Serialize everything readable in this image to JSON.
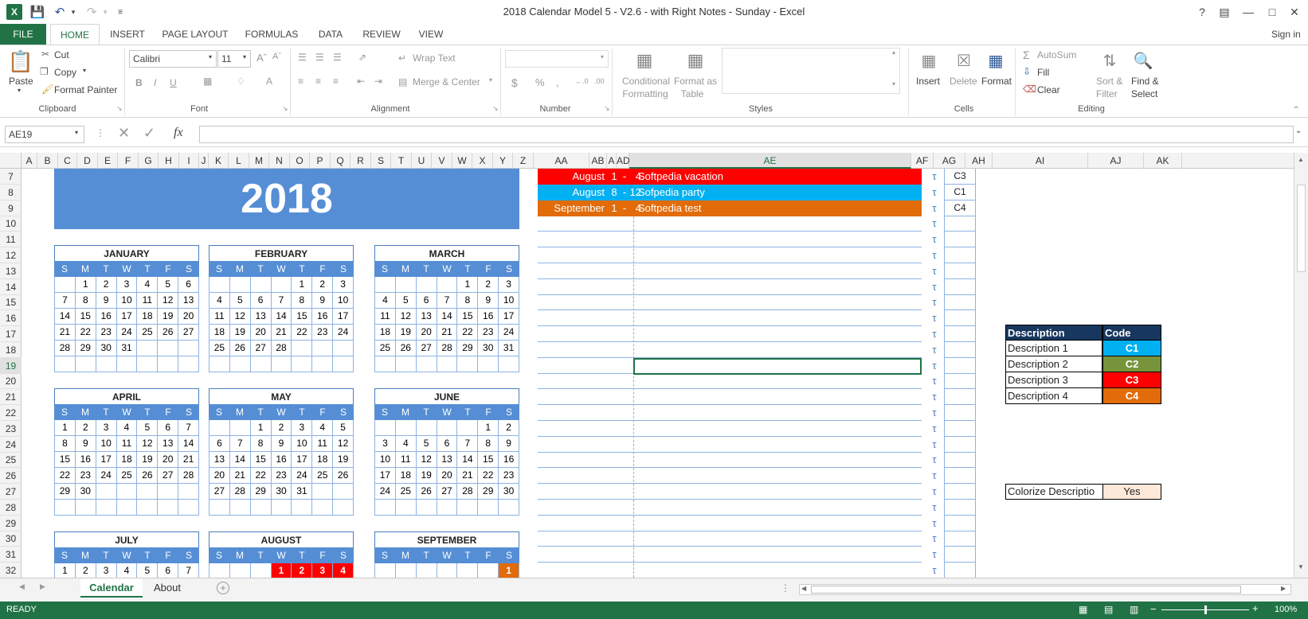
{
  "window": {
    "title": "2018 Calendar Model 5 - V2.6 - with Right Notes - Sunday - Excel",
    "help": "?",
    "signin": "Sign in"
  },
  "tabs": [
    "FILE",
    "HOME",
    "INSERT",
    "PAGE LAYOUT",
    "FORMULAS",
    "DATA",
    "REVIEW",
    "VIEW"
  ],
  "ribbon": {
    "clipboard": {
      "paste": "Paste",
      "cut": "Cut",
      "copy": "Copy",
      "format_painter": "Format Painter",
      "label": "Clipboard"
    },
    "font": {
      "name": "Calibri",
      "size": "11",
      "label": "Font"
    },
    "alignment": {
      "wrap": "Wrap Text",
      "merge": "Merge & Center",
      "label": "Alignment"
    },
    "number": {
      "label": "Number"
    },
    "styles": {
      "cond1": "Conditional",
      "cond2": "Formatting",
      "fmt1": "Format as",
      "fmt2": "Table",
      "label": "Styles"
    },
    "cells": {
      "insert": "Insert",
      "delete": "Delete",
      "format": "Format",
      "label": "Cells"
    },
    "editing": {
      "autosum": "AutoSum",
      "fill": "Fill",
      "clear": "Clear",
      "sort1": "Sort &",
      "sort2": "Filter",
      "find1": "Find &",
      "find2": "Select",
      "label": "Editing"
    }
  },
  "formula_bar": {
    "name_box": "AE19",
    "fx": "fx",
    "content": ""
  },
  "columns": [
    {
      "l": "A",
      "w": 20
    },
    {
      "l": "B",
      "w": 26
    },
    {
      "l": "C",
      "w": 24
    },
    {
      "l": "D",
      "w": 26
    },
    {
      "l": "E",
      "w": 25
    },
    {
      "l": "F",
      "w": 26
    },
    {
      "l": "G",
      "w": 25
    },
    {
      "l": "H",
      "w": 26
    },
    {
      "l": "I",
      "w": 25
    },
    {
      "l": "J",
      "w": 12
    },
    {
      "l": "K",
      "w": 25
    },
    {
      "l": "L",
      "w": 26
    },
    {
      "l": "M",
      "w": 25
    },
    {
      "l": "N",
      "w": 26
    },
    {
      "l": "O",
      "w": 25
    },
    {
      "l": "P",
      "w": 26
    },
    {
      "l": "Q",
      "w": 25
    },
    {
      "l": "R",
      "w": 26
    },
    {
      "l": "S",
      "w": 25
    },
    {
      "l": "T",
      "w": 26
    },
    {
      "l": "U",
      "w": 25
    },
    {
      "l": "V",
      "w": 26
    },
    {
      "l": "W",
      "w": 25
    },
    {
      "l": "X",
      "w": 26
    },
    {
      "l": "Y",
      "w": 25
    },
    {
      "l": "Z",
      "w": 26
    },
    {
      "l": "AA",
      "w": 70
    },
    {
      "l": "AB",
      "w": 22
    },
    {
      "l": "A",
      "w": 12
    },
    {
      "l": "AD",
      "w": 16
    },
    {
      "l": "AE",
      "w": 354
    },
    {
      "l": "AF",
      "w": 28
    },
    {
      "l": "AG",
      "w": 40
    },
    {
      "l": "AH",
      "w": 34
    },
    {
      "l": "AI",
      "w": 120
    },
    {
      "l": "AJ",
      "w": 70
    },
    {
      "l": "AK",
      "w": 48
    }
  ],
  "rows": [
    "7",
    "8",
    "9",
    "10",
    "11",
    "12",
    "13",
    "14",
    "15",
    "16",
    "17",
    "18",
    "19",
    "20",
    "21",
    "22",
    "23",
    "24",
    "25",
    "26",
    "27",
    "28",
    "29",
    "30",
    "31",
    "32"
  ],
  "active_cell": "AE19",
  "year": "2018",
  "dow": [
    "S",
    "M",
    "T",
    "W",
    "T",
    "F",
    "S"
  ],
  "months": [
    {
      "name": "JANUARY",
      "weeks": [
        [
          "",
          "1",
          "2",
          "3",
          "4",
          "5",
          "6"
        ],
        [
          "7",
          "8",
          "9",
          "10",
          "11",
          "12",
          "13"
        ],
        [
          "14",
          "15",
          "16",
          "17",
          "18",
          "19",
          "20"
        ],
        [
          "21",
          "22",
          "23",
          "24",
          "25",
          "26",
          "27"
        ],
        [
          "28",
          "29",
          "30",
          "31",
          "",
          "",
          ""
        ],
        [
          "",
          "",
          "",
          "",
          "",
          "",
          ""
        ]
      ]
    },
    {
      "name": "FEBRUARY",
      "weeks": [
        [
          "",
          "",
          "",
          "",
          "1",
          "2",
          "3"
        ],
        [
          "4",
          "5",
          "6",
          "7",
          "8",
          "9",
          "10"
        ],
        [
          "11",
          "12",
          "13",
          "14",
          "15",
          "16",
          "17"
        ],
        [
          "18",
          "19",
          "20",
          "21",
          "22",
          "23",
          "24"
        ],
        [
          "25",
          "26",
          "27",
          "28",
          "",
          "",
          ""
        ],
        [
          "",
          "",
          "",
          "",
          "",
          "",
          ""
        ]
      ]
    },
    {
      "name": "MARCH",
      "weeks": [
        [
          "",
          "",
          "",
          "",
          "1",
          "2",
          "3"
        ],
        [
          "4",
          "5",
          "6",
          "7",
          "8",
          "9",
          "10"
        ],
        [
          "11",
          "12",
          "13",
          "14",
          "15",
          "16",
          "17"
        ],
        [
          "18",
          "19",
          "20",
          "21",
          "22",
          "23",
          "24"
        ],
        [
          "25",
          "26",
          "27",
          "28",
          "29",
          "30",
          "31"
        ],
        [
          "",
          "",
          "",
          "",
          "",
          "",
          ""
        ]
      ]
    },
    {
      "name": "APRIL",
      "weeks": [
        [
          "1",
          "2",
          "3",
          "4",
          "5",
          "6",
          "7"
        ],
        [
          "8",
          "9",
          "10",
          "11",
          "12",
          "13",
          "14"
        ],
        [
          "15",
          "16",
          "17",
          "18",
          "19",
          "20",
          "21"
        ],
        [
          "22",
          "23",
          "24",
          "25",
          "26",
          "27",
          "28"
        ],
        [
          "29",
          "30",
          "",
          "",
          "",
          "",
          ""
        ],
        [
          "",
          "",
          "",
          "",
          "",
          "",
          ""
        ]
      ]
    },
    {
      "name": "MAY",
      "weeks": [
        [
          "",
          "",
          "1",
          "2",
          "3",
          "4",
          "5"
        ],
        [
          "6",
          "7",
          "8",
          "9",
          "10",
          "11",
          "12"
        ],
        [
          "13",
          "14",
          "15",
          "16",
          "17",
          "18",
          "19"
        ],
        [
          "20",
          "21",
          "22",
          "23",
          "24",
          "25",
          "26"
        ],
        [
          "27",
          "28",
          "29",
          "30",
          "31",
          "",
          ""
        ],
        [
          "",
          "",
          "",
          "",
          "",
          "",
          ""
        ]
      ]
    },
    {
      "name": "JUNE",
      "weeks": [
        [
          "",
          "",
          "",
          "",
          "",
          "1",
          "2"
        ],
        [
          "3",
          "4",
          "5",
          "6",
          "7",
          "8",
          "9"
        ],
        [
          "10",
          "11",
          "12",
          "13",
          "14",
          "15",
          "16"
        ],
        [
          "17",
          "18",
          "19",
          "20",
          "21",
          "22",
          "23"
        ],
        [
          "24",
          "25",
          "26",
          "27",
          "28",
          "29",
          "30"
        ],
        [
          "",
          "",
          "",
          "",
          "",
          "",
          ""
        ]
      ]
    },
    {
      "name": "JULY",
      "weeks": [
        [
          "1",
          "2",
          "3",
          "4",
          "5",
          "6",
          "7"
        ]
      ]
    },
    {
      "name": "AUGUST",
      "weeks": [
        [
          "",
          "",
          "",
          "1",
          "2",
          "3",
          "4"
        ]
      ],
      "highlight": {
        "1": "red",
        "2": "red",
        "3": "red",
        "4": "red"
      }
    },
    {
      "name": "SEPTEMBER",
      "weeks": [
        [
          "",
          "",
          "",
          "",
          "",
          "",
          "1"
        ]
      ],
      "highlight": {
        "1": "orange"
      }
    }
  ],
  "notes": [
    {
      "month": "August",
      "from": "1",
      "dash": "-",
      "to": "4",
      "text": "Softpedia vacation",
      "color": "#ff0000",
      "code": "C3"
    },
    {
      "month": "August",
      "from": "8",
      "dash": "-",
      "to": "12",
      "text": "Sofpedia party",
      "color": "#00b0f0",
      "code": "C1"
    },
    {
      "month": "September",
      "from": "1",
      "dash": "-",
      "to": "4",
      "text": "Softpedia test",
      "color": "#e26b0a",
      "code": "C4"
    }
  ],
  "tau": "τ",
  "legend": {
    "headers": [
      "Description",
      "Code"
    ],
    "rows": [
      {
        "d": "Description 1",
        "c": "C1",
        "color": "#00b0f0"
      },
      {
        "d": "Description 2",
        "c": "C2",
        "color": "#77933c"
      },
      {
        "d": "Description 3",
        "c": "C3",
        "color": "#ff0000"
      },
      {
        "d": "Description 4",
        "c": "C4",
        "color": "#e26b0a"
      }
    ],
    "colorize_label": "Colorize Descriptio",
    "colorize_value": "Yes"
  },
  "sheets": [
    "Calendar",
    "About"
  ],
  "status": {
    "mode": "READY",
    "zoom": "100%"
  }
}
